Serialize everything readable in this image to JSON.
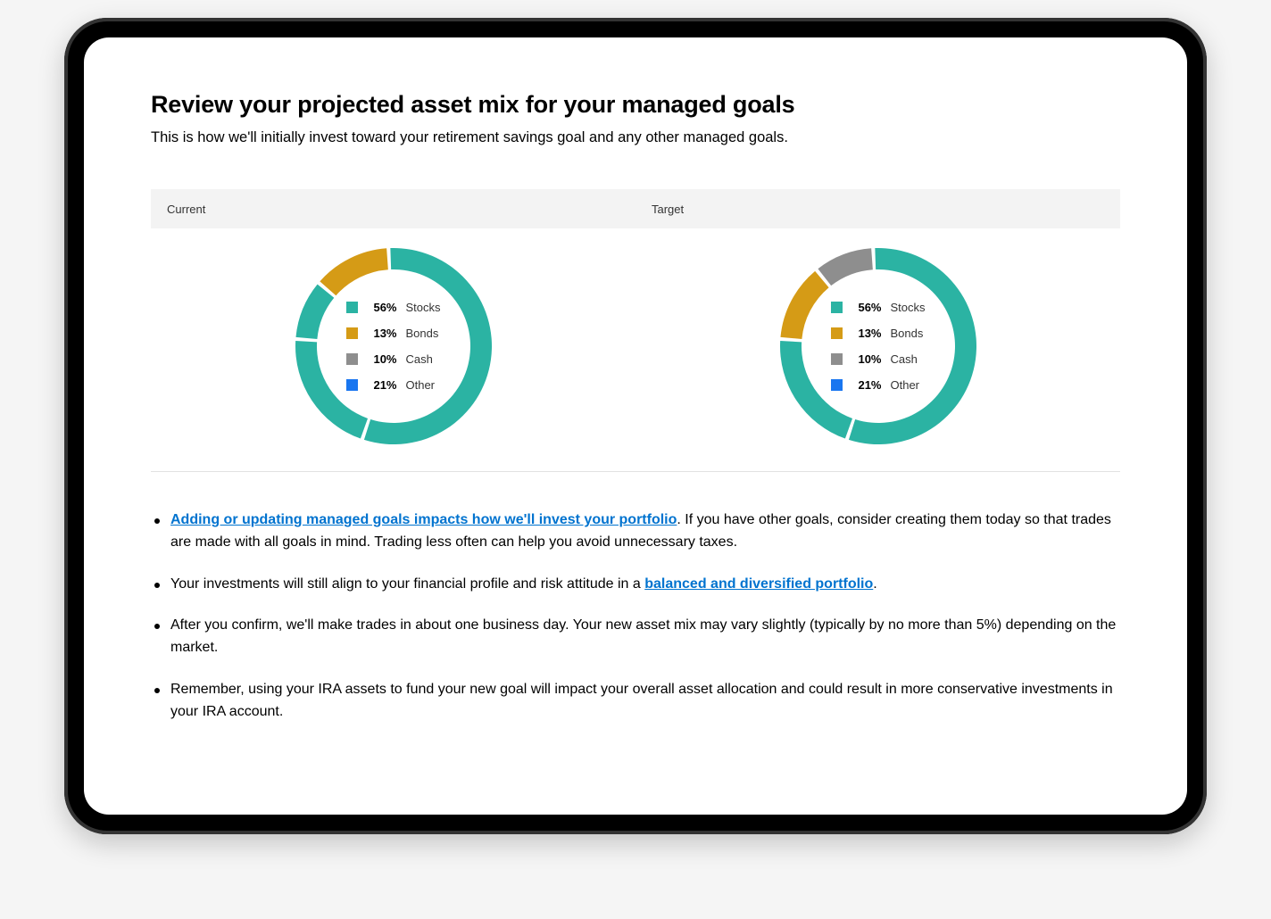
{
  "title": "Review your projected asset mix for your managed goals",
  "subtitle": "This is how we'll initially invest toward your retirement savings goal and any other managed goals.",
  "columns": {
    "current": "Current",
    "target": "Target"
  },
  "legend_labels": {
    "stocks": "Stocks",
    "bonds": "Bonds",
    "cash": "Cash",
    "other": "Other"
  },
  "colors": {
    "stocks": "#2bb3a3",
    "bonds": "#d59b16",
    "cash": "#8e8e8e",
    "other": "#1976f0",
    "gap": "#ffffff"
  },
  "bullets": {
    "b1_link": "Adding or updating managed goals impacts how we'll invest your portfolio",
    "b1_rest": ". If you have other goals, consider creating them today so that trades are made with all goals in mind. Trading less often can help you avoid unnecessary taxes.",
    "b2_pre": "Your investments will still align to your financial profile and risk attitude in a ",
    "b2_link": "balanced and diversified portfolio",
    "b2_post": ".",
    "b3": "After you confirm, we'll make trades in about one business day. Your new asset mix may vary slightly (typically by no more than 5%) depending on the market.",
    "b4": "Remember, using your IRA assets to fund your new goal will impact your overall asset allocation and could result in more conservative investments in your IRA account."
  },
  "chart_data": [
    {
      "type": "pie",
      "title": "Current",
      "series": [
        {
          "name": "Stocks",
          "value": 56,
          "color": "#2bb3a3"
        },
        {
          "name": "Bonds",
          "value": 13,
          "color": "#d59b16"
        },
        {
          "name": "Cash",
          "value": 10,
          "color": "#8e8e8e"
        },
        {
          "name": "Other",
          "value": 21,
          "color": "#1976f0"
        }
      ],
      "legend_pct": {
        "stocks": "56%",
        "bonds": "13%",
        "cash": "10%",
        "other": "21%"
      }
    },
    {
      "type": "pie",
      "title": "Target",
      "series": [
        {
          "name": "Stocks",
          "value": 56,
          "color": "#2bb3a3"
        },
        {
          "name": "Bonds",
          "value": 13,
          "color": "#d59b16"
        },
        {
          "name": "Cash",
          "value": 10,
          "color": "#8e8e8e"
        },
        {
          "name": "Other",
          "value": 21,
          "color": "#1976f0"
        }
      ],
      "legend_pct": {
        "stocks": "56%",
        "bonds": "13%",
        "cash": "10%",
        "other": "21%"
      }
    }
  ]
}
